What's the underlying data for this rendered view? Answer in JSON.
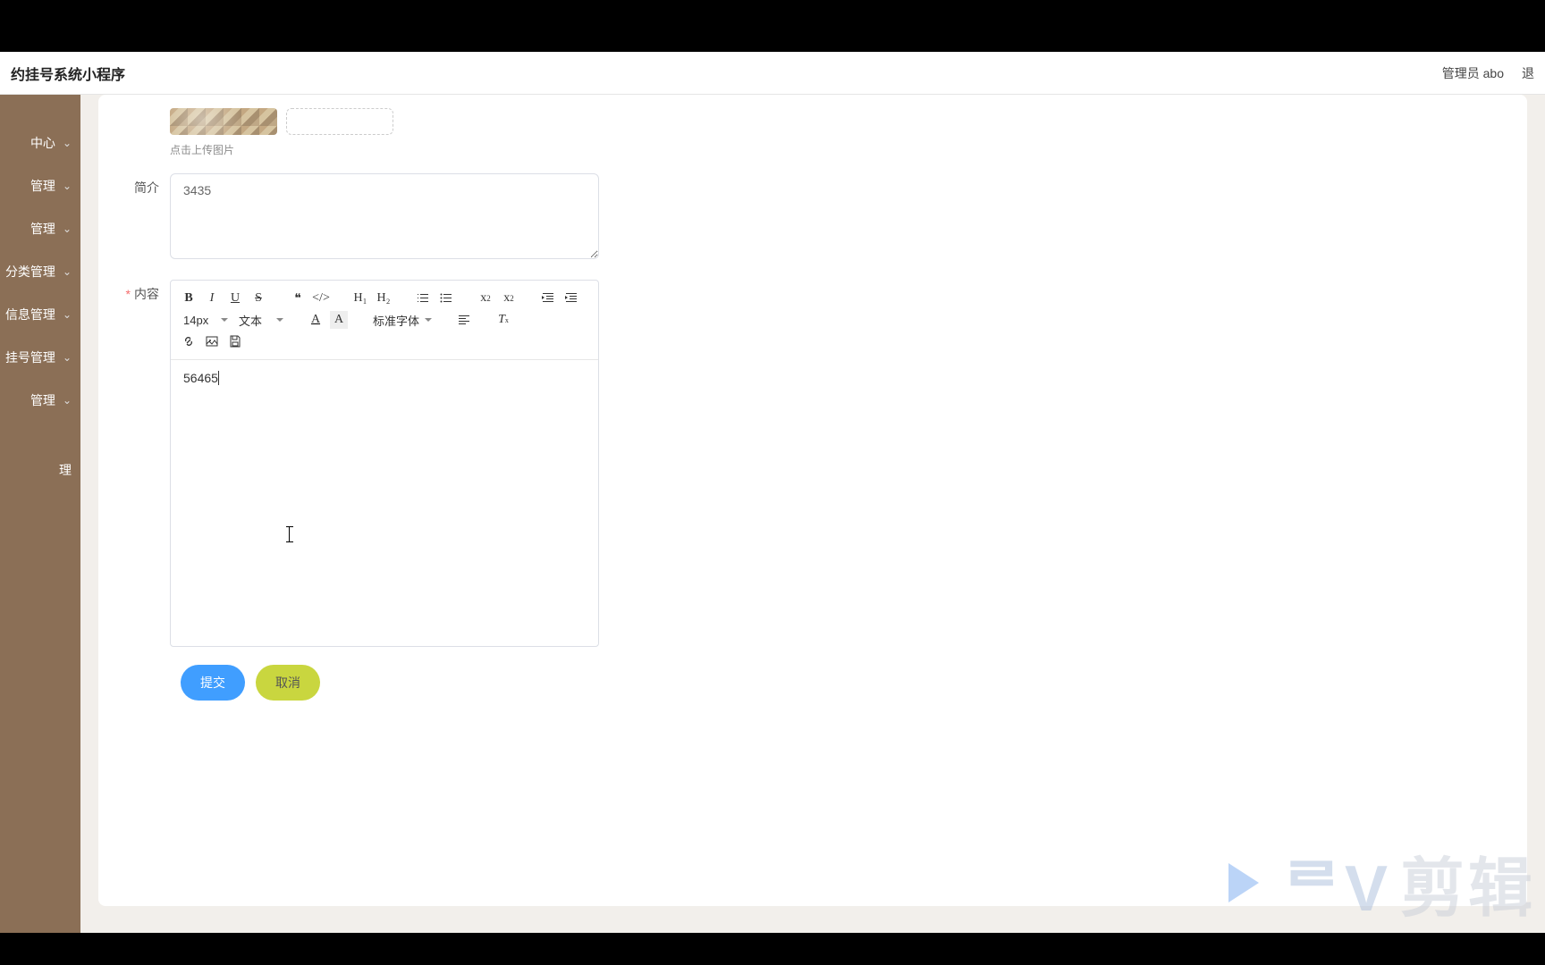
{
  "header": {
    "title": "约挂号系统小程序",
    "admin_label": "管理员 abo",
    "logout_partial": "退"
  },
  "sidebar": {
    "items": [
      {
        "label": "中心"
      },
      {
        "label": "管理"
      },
      {
        "label": "管理"
      },
      {
        "label": "分类管理"
      },
      {
        "label": "信息管理"
      },
      {
        "label": "挂号管理"
      },
      {
        "label": "管理"
      }
    ],
    "single": "理"
  },
  "form": {
    "upload_tip": "点击上传图片",
    "intro_label": "简介",
    "intro_value": "3435",
    "content_label": "内容",
    "editor_content": "56465"
  },
  "toolbar": {
    "font_size": "14px",
    "text_label": "文本",
    "font_family": "标准字体"
  },
  "buttons": {
    "submit": "提交",
    "cancel": "取消"
  },
  "watermark": {
    "text": "剪辑"
  }
}
